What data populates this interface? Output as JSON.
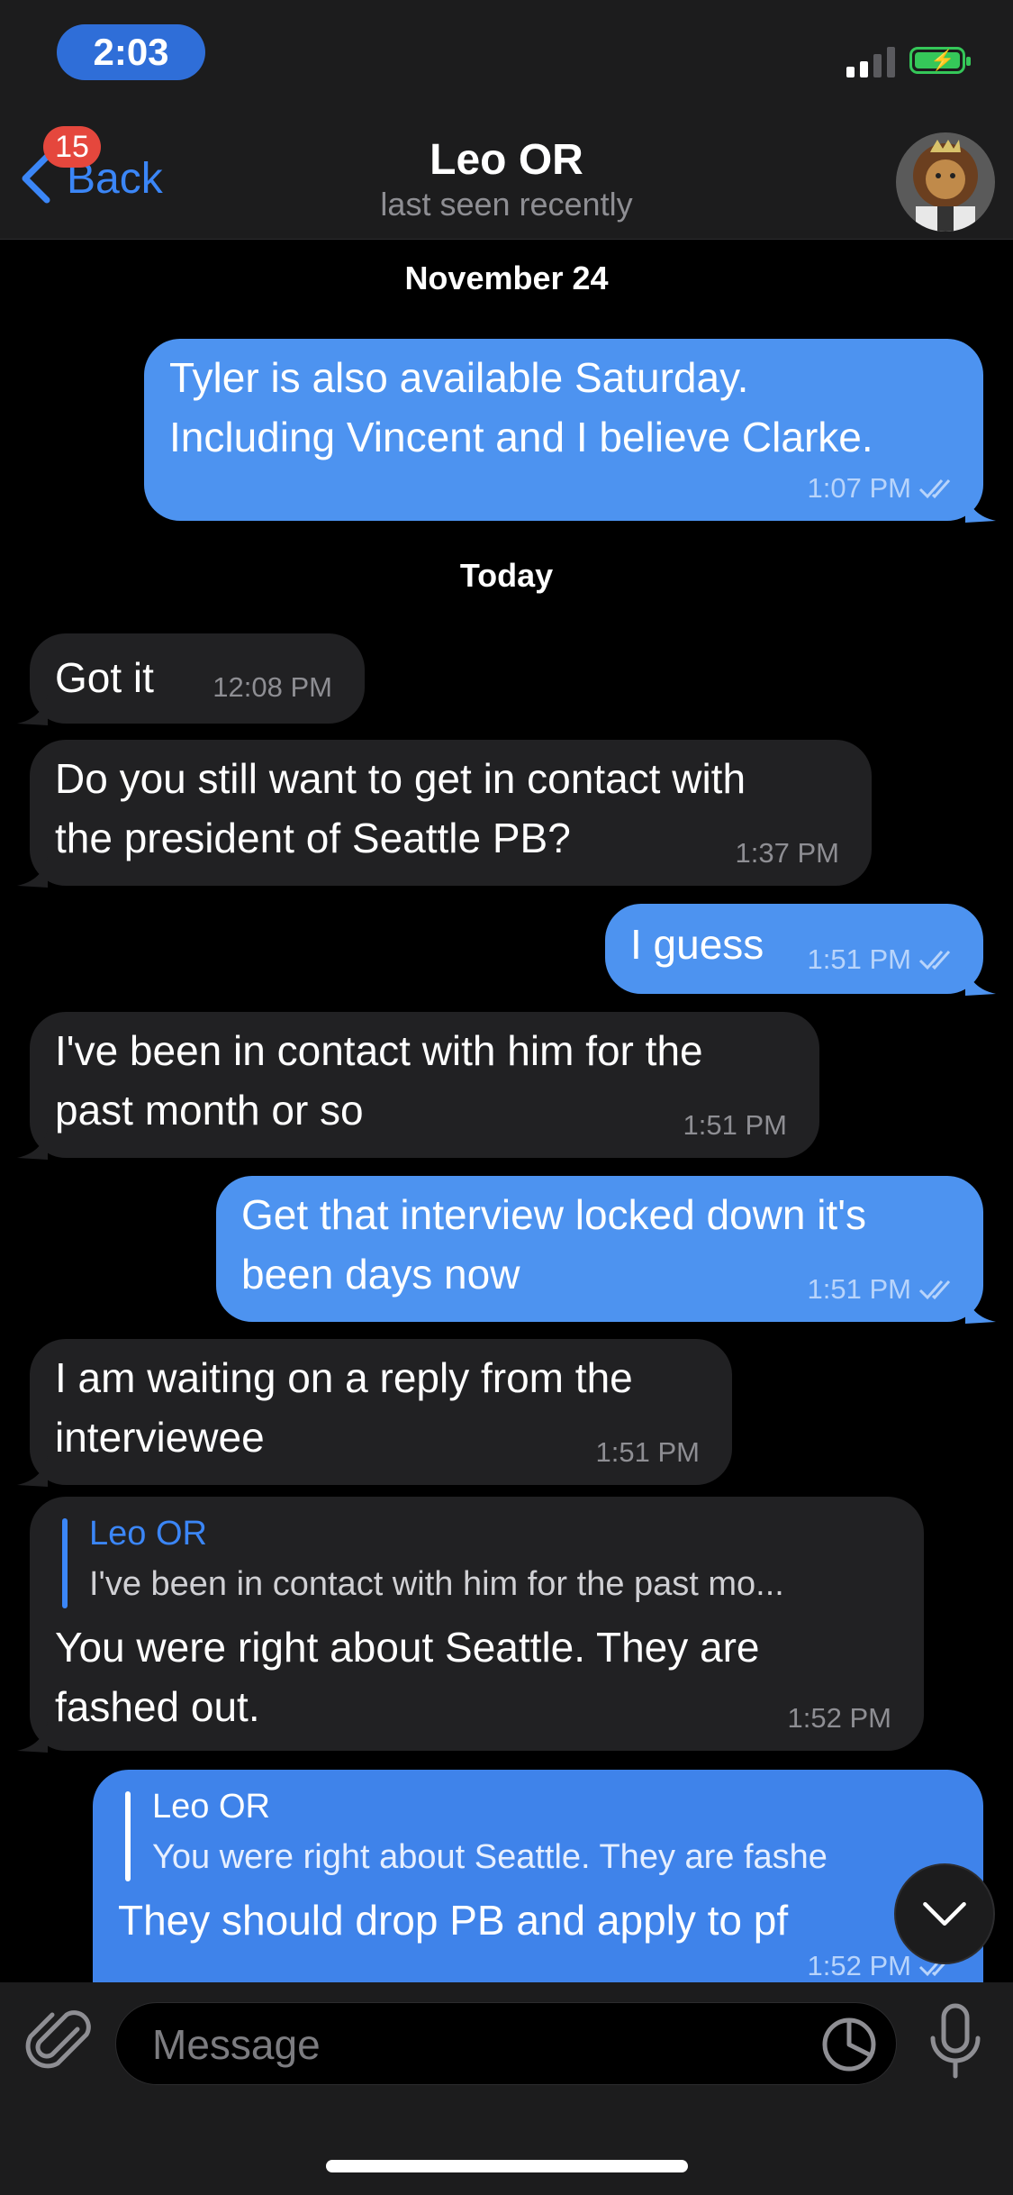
{
  "status_bar": {
    "time": "2:03"
  },
  "header": {
    "back_label": "Back",
    "unread_badge": "15",
    "contact_name": "Leo OR",
    "contact_status": "last seen recently"
  },
  "dates": [
    "November 24",
    "Today"
  ],
  "messages": [
    {
      "direction": "outgoing",
      "text": "Tyler is also available Saturday.\nIncluding Vincent and I believe Clarke.",
      "time": "1:07 PM",
      "read": true
    },
    {
      "direction": "incoming",
      "text": "Got it",
      "time": "12:08 PM"
    },
    {
      "direction": "incoming",
      "text": "Do you still want to get in contact with\nthe president of Seattle PB?",
      "time": "1:37 PM"
    },
    {
      "direction": "outgoing",
      "text": "I guess",
      "time": "1:51 PM",
      "read": true
    },
    {
      "direction": "incoming",
      "text": "I've been in contact with him for the\npast month or so",
      "time": "1:51 PM"
    },
    {
      "direction": "outgoing",
      "text": "Get that interview locked down it's\nbeen days now",
      "time": "1:51 PM",
      "read": true
    },
    {
      "direction": "incoming",
      "text": "I am waiting on a reply from the\ninterviewee",
      "time": "1:51 PM"
    },
    {
      "direction": "incoming",
      "reply_to_name": "Leo OR",
      "reply_to_text": "I've been in contact with him for the past mo...",
      "text": "You were right about Seattle. They are\nfashed out.",
      "time": "1:52 PM"
    },
    {
      "direction": "outgoing",
      "reply_to_name": "Leo OR",
      "reply_to_text": "You were right about Seattle. They are fashe",
      "text": "They should drop PB and apply to pf",
      "time": "1:52 PM",
      "read": true
    }
  ],
  "composer": {
    "placeholder": "Message"
  },
  "colors": {
    "accent": "#3b86f7",
    "outgoing_bubble": "#4d93f0",
    "incoming_bubble": "#212123",
    "badge": "#e5473d"
  },
  "icons": [
    "back-chevron-icon",
    "paperclip-icon",
    "sticker-icon",
    "microphone-icon",
    "chevron-down-icon",
    "double-check-icon"
  ]
}
